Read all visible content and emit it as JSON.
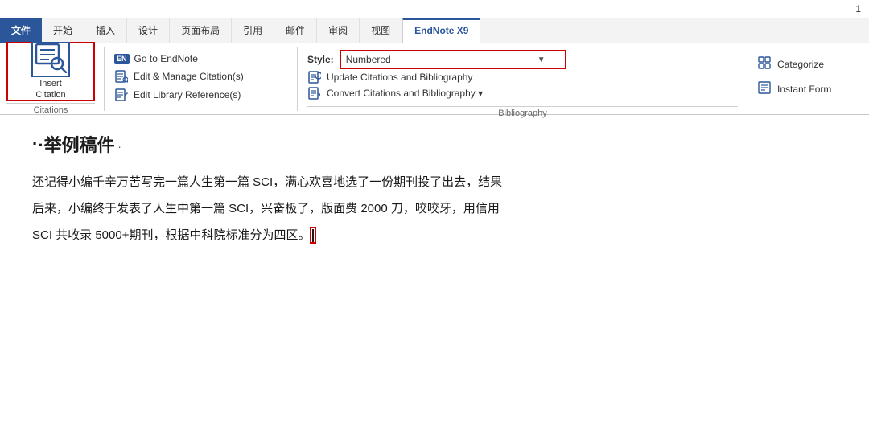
{
  "topbar": {
    "page_number": "1"
  },
  "tabs": [
    {
      "label": "文件",
      "key": "file",
      "active": "blue"
    },
    {
      "label": "开始",
      "key": "home"
    },
    {
      "label": "插入",
      "key": "insert"
    },
    {
      "label": "设计",
      "key": "design"
    },
    {
      "label": "页面布局",
      "key": "layout"
    },
    {
      "label": "引用",
      "key": "references"
    },
    {
      "label": "邮件",
      "key": "mailings"
    },
    {
      "label": "审阅",
      "key": "review"
    },
    {
      "label": "视图",
      "key": "view"
    },
    {
      "label": "EndNote X9",
      "key": "endnote",
      "active": "endnote"
    }
  ],
  "groups": {
    "insert_citation": {
      "button_label_line1": "Insert",
      "button_label_line2": "Citation",
      "label": "Citations"
    },
    "citations": {
      "items": [
        {
          "icon": "EN",
          "type": "badge",
          "text": "Go to EndNote"
        },
        {
          "icon": "🔖",
          "type": "symbol",
          "text": "Edit & Manage Citation(s)"
        },
        {
          "icon": "📚",
          "type": "symbol",
          "text": "Edit Library Reference(s)"
        }
      ],
      "label": "Citations"
    },
    "bibliography": {
      "style_label": "Style:",
      "style_value": "Numbered",
      "items": [
        {
          "icon": "↻",
          "text": "Update Citations and Bibliography"
        },
        {
          "icon": "🔄",
          "text": "Convert Citations and Bibliography ▾"
        }
      ],
      "label": "Bibliography"
    },
    "right": {
      "items": [
        {
          "icon": "⚙",
          "text": "Categorize"
        },
        {
          "icon": "▦",
          "text": "Instant Form"
        }
      ]
    }
  },
  "document": {
    "heading": "·举例稿件",
    "paragraphs": [
      "还记得小编千辛万苦写完一篇人生第一篇 SCI，满心欢喜地选了一份期刊投了出去，结果",
      "后来，小编终于发表了人生中第一篇 SCI，兴奋极了，版面费 2000 刀，咬咬牙，用信用",
      "SCI 共收录 5000+期刊，根据中科院标准分为四区。"
    ]
  }
}
